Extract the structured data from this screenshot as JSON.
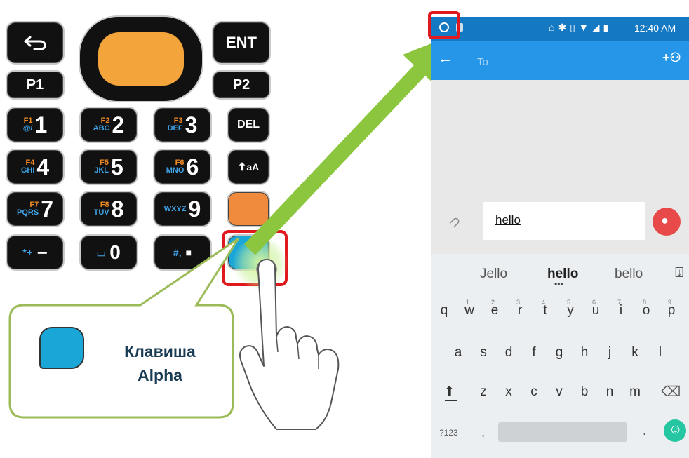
{
  "keypad": {
    "back_icon": "return-arrow-icon",
    "enter_label": "ENT",
    "p1_label": "P1",
    "p2_label": "P2",
    "del_label": "DEL",
    "shift_label": "aA",
    "keys": [
      {
        "fn": "F1",
        "sub": "@/",
        "num": "1"
      },
      {
        "fn": "F2",
        "sub": "ABC",
        "num": "2"
      },
      {
        "fn": "F3",
        "sub": "DEF",
        "num": "3"
      },
      {
        "fn": "F4",
        "sub": "GHI",
        "num": "4"
      },
      {
        "fn": "F5",
        "sub": "JKL",
        "num": "5"
      },
      {
        "fn": "F6",
        "sub": "MNO",
        "num": "6"
      },
      {
        "fn": "F7",
        "sub": "PQRS",
        "num": "7"
      },
      {
        "fn": "F8",
        "sub": "TUV",
        "num": "8"
      },
      {
        "fn": "",
        "sub": "WXYZ",
        "num": "9"
      }
    ],
    "bottom_row": [
      {
        "sub": "*+",
        "num": "−"
      },
      {
        "sub": "⌴",
        "num": "0"
      },
      {
        "sub": "#,",
        "num": "■"
      }
    ],
    "colors": {
      "scan": "#f3a43a",
      "orange_key": "#f08a3c",
      "alpha_key": "#1aa7d8",
      "highlight": "#e0191f",
      "arrow": "#8cc63f",
      "callout_border": "#9bbb59"
    }
  },
  "callout": {
    "line1": "Клавиша",
    "line2": "Alpha"
  },
  "phone": {
    "status": {
      "time": "12:40 AM",
      "left_icon": "circle-icon",
      "icons": "cast bluetooth vibrate wifi signal battery"
    },
    "appbar": {
      "to_placeholder": "To",
      "add_contact_icon": "add-person-icon",
      "back_icon": "back-arrow-icon"
    },
    "composer": {
      "text": "hello",
      "attach_icon": "paperclip-icon",
      "send_icon": "person-icon"
    },
    "suggestions": [
      "Jello",
      "hello",
      "bello"
    ],
    "mic_icon": "mic-icon",
    "row1": [
      "q",
      "w",
      "e",
      "r",
      "t",
      "y",
      "u",
      "i",
      "o",
      "p"
    ],
    "row1_hints": [
      "1",
      "2",
      "3",
      "4",
      "5",
      "6",
      "7",
      "8",
      "9"
    ],
    "row2": [
      "a",
      "s",
      "d",
      "f",
      "g",
      "h",
      "j",
      "k",
      "l"
    ],
    "row3": [
      "z",
      "x",
      "c",
      "v",
      "b",
      "n",
      "m"
    ],
    "sym_label": "?123",
    "comma": ",",
    "period": ".",
    "shift_icon": "shift-icon",
    "backspace_icon": "backspace-icon",
    "emoji_icon": "emoji-icon"
  }
}
